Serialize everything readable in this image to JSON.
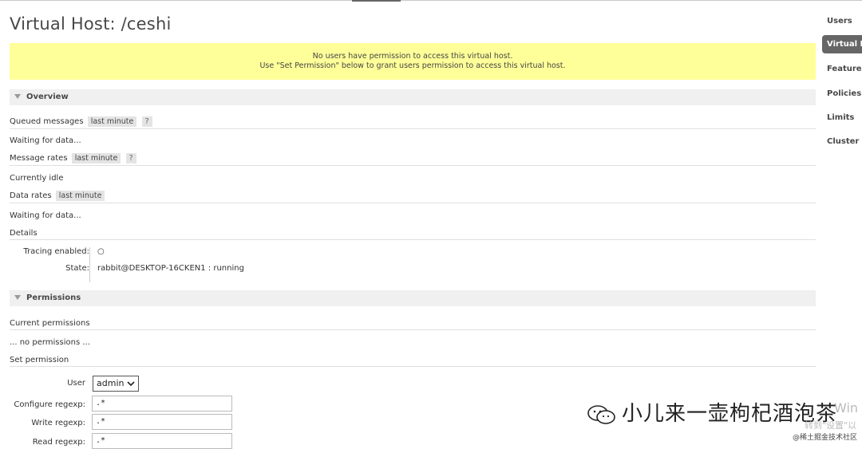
{
  "page": {
    "title": "Virtual Host: /ceshi",
    "warning_line1": "No users have permission to access this virtual host.",
    "warning_line2": "Use \"Set Permission\" below to grant users permission to access this virtual host."
  },
  "overview": {
    "header": "Overview",
    "queued_label": "Queued messages",
    "queued_range": "last minute",
    "queued_help": "?",
    "queued_status": "Waiting for data...",
    "msg_rates_label": "Message rates",
    "msg_rates_range": "last minute",
    "msg_rates_help": "?",
    "msg_rates_status": "Currently idle",
    "data_rates_label": "Data rates",
    "data_rates_range": "last minute",
    "data_rates_status": "Waiting for data...",
    "details_label": "Details",
    "tracing_label": "Tracing enabled:",
    "tracing_value": "○",
    "state_label": "State:",
    "state_node": "rabbit@DESKTOP-16CKEN1 :",
    "state_value": "running"
  },
  "permissions": {
    "header": "Permissions",
    "current_label": "Current permissions",
    "current_value": "... no permissions ...",
    "set_label": "Set permission",
    "user_label": "User",
    "user_selected": "admin",
    "configure_label": "Configure regexp:",
    "configure_value": ".*",
    "write_label": "Write regexp:",
    "write_value": ".*",
    "read_label": "Read regexp:",
    "read_value": ".*"
  },
  "nav": {
    "items": [
      "Users",
      "Virtual H",
      "Feature",
      "Policies",
      "Limits",
      "Cluster"
    ],
    "active_index": 1
  },
  "watermark": {
    "text": "小儿来一壶枸杞酒泡茶",
    "side": "Win",
    "sub": "转到\"设置\"以",
    "tag": "@稀土掘金技术社区"
  }
}
